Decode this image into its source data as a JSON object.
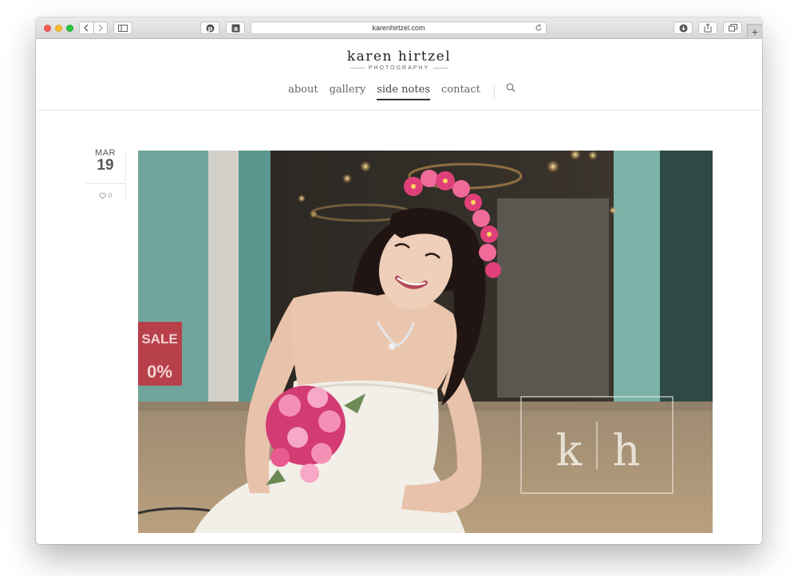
{
  "browser": {
    "url": "karenhirtzel.com",
    "icons": [
      "back-icon",
      "forward-icon",
      "sidebar-icon",
      "pinterest-icon",
      "amazon-icon",
      "reload-icon",
      "download-icon",
      "share-icon",
      "tabs-icon",
      "new-tab-icon"
    ],
    "new_tab_label": "+"
  },
  "site": {
    "logo_name": "karen hirtzel",
    "logo_sub": "PHOTOGRAPHY",
    "nav": [
      {
        "label": "about",
        "active": false
      },
      {
        "label": "gallery",
        "active": false
      },
      {
        "label": "side notes",
        "active": true
      },
      {
        "label": "contact",
        "active": false
      }
    ]
  },
  "post": {
    "month": "MAR",
    "day": "19",
    "likes": "0",
    "photo_watermark_left": "k",
    "photo_watermark_right": "h",
    "photo_sign": "SALE",
    "photo_sign_percent": "0%"
  },
  "colors": {
    "accent": "#333333",
    "nav_text": "#666666",
    "flower_pink": "#e0407a"
  }
}
